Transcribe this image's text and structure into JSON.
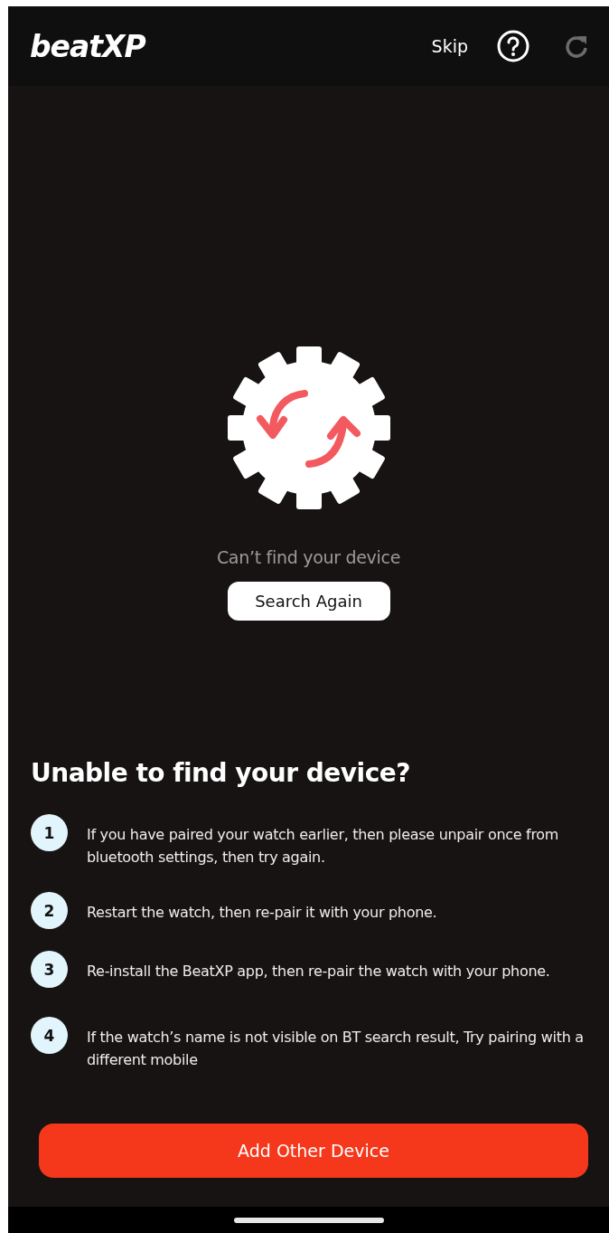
{
  "header": {
    "logo": "beatXP",
    "skip": "Skip",
    "refresh_disabled": true
  },
  "status": {
    "message": "Can’t find your device",
    "button": "Search Again"
  },
  "help": {
    "title": "Unable to find your device?",
    "steps": [
      {
        "number": "1",
        "text": "If you have paired your watch earlier, then please unpair once from bluetooth settings, then try again."
      },
      {
        "number": "2",
        "text": "Restart the watch, then re-pair it with your phone."
      },
      {
        "number": "3",
        "text": "Re-install the BeatXP app, then re-pair the watch with your phone."
      },
      {
        "number": "4",
        "text": "If the watch’s name is not visible on BT search result, Try pairing with a different mobile"
      }
    ]
  },
  "primary_button": "Add Other Device"
}
